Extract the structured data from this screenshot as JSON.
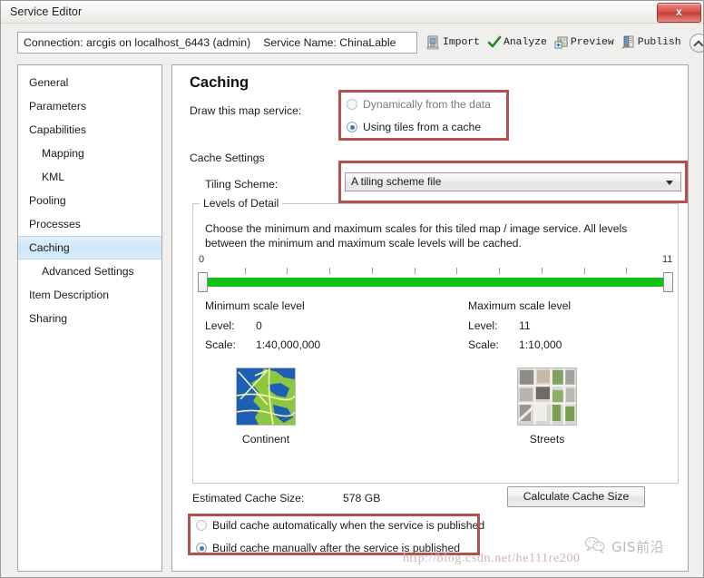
{
  "window": {
    "title": "Service Editor",
    "close_label": "x"
  },
  "toolbar": {
    "connection_label": "Connection: arcgis on localhost_6443 (admin)",
    "service_name_label": "Service Name: ChinaLable",
    "actions": [
      {
        "label": "Import",
        "icon": "import-icon"
      },
      {
        "label": "Analyze",
        "icon": "checkmark-icon"
      },
      {
        "label": "Preview",
        "icon": "preview-icon"
      },
      {
        "label": "Publish",
        "icon": "publish-icon"
      }
    ],
    "collapse_icon": "chevron-up-icon"
  },
  "sidebar": {
    "items": [
      {
        "label": "General",
        "sub": false,
        "active": false
      },
      {
        "label": "Parameters",
        "sub": false,
        "active": false
      },
      {
        "label": "Capabilities",
        "sub": false,
        "active": false
      },
      {
        "label": "Mapping",
        "sub": true,
        "active": false
      },
      {
        "label": "KML",
        "sub": true,
        "active": false
      },
      {
        "label": "Pooling",
        "sub": false,
        "active": false
      },
      {
        "label": "Processes",
        "sub": false,
        "active": false
      },
      {
        "label": "Caching",
        "sub": false,
        "active": true
      },
      {
        "label": "Advanced Settings",
        "sub": true,
        "active": false
      },
      {
        "label": "Item Description",
        "sub": false,
        "active": false
      },
      {
        "label": "Sharing",
        "sub": false,
        "active": false
      }
    ]
  },
  "page": {
    "heading": "Caching",
    "draw_label": "Draw this map service:",
    "draw_options": [
      {
        "label": "Dynamically from the data",
        "selected": false,
        "disabled": true
      },
      {
        "label": "Using tiles from a cache",
        "selected": true,
        "disabled": false
      }
    ],
    "cache_settings_label": "Cache Settings",
    "tiling_scheme_label": "Tiling Scheme:",
    "tiling_scheme_value": "A tiling scheme file",
    "levels_group_title": "Levels of Detail",
    "levels_description": "Choose the minimum and maximum scales for this tiled map / image service. All levels between the minimum and maximum scale levels will be cached.",
    "slider": {
      "min_handle_label": "0",
      "max_handle_label": "11",
      "level_min": 0,
      "level_max": 11,
      "tick_count": 12,
      "fill_color": "#12c212"
    },
    "minimum": {
      "heading": "Minimum scale level",
      "level_key": "Level:",
      "level_value": "0",
      "scale_key": "Scale:",
      "scale_value": "1:40,000,000"
    },
    "maximum": {
      "heading": "Maximum scale level",
      "level_key": "Level:",
      "level_value": "11",
      "scale_key": "Scale:",
      "scale_value": "1:10,000"
    },
    "thumbnails": [
      {
        "caption": "Continent",
        "icon": "world-map-thumbnail"
      },
      {
        "caption": "Streets",
        "icon": "city-blocks-thumbnail"
      }
    ],
    "estimated_cache_label": "Estimated Cache Size:",
    "estimated_cache_value": "578 GB",
    "calculate_button": "Calculate Cache Size",
    "build_options": [
      {
        "label": "Build cache automatically when the service is published",
        "selected": false
      },
      {
        "label": "Build cache manually after the service is published",
        "selected": true
      }
    ]
  },
  "watermark": {
    "url": "http://blog.csdn.net/he111re200",
    "badge_text": "GIS前沿",
    "badge_icon": "wechat-icon"
  },
  "colors": {
    "highlight_red": "#b4514f",
    "selection_blue": "#cfe6f7",
    "radio_dot": "#2f7dc2",
    "slider_green": "#12c212"
  }
}
